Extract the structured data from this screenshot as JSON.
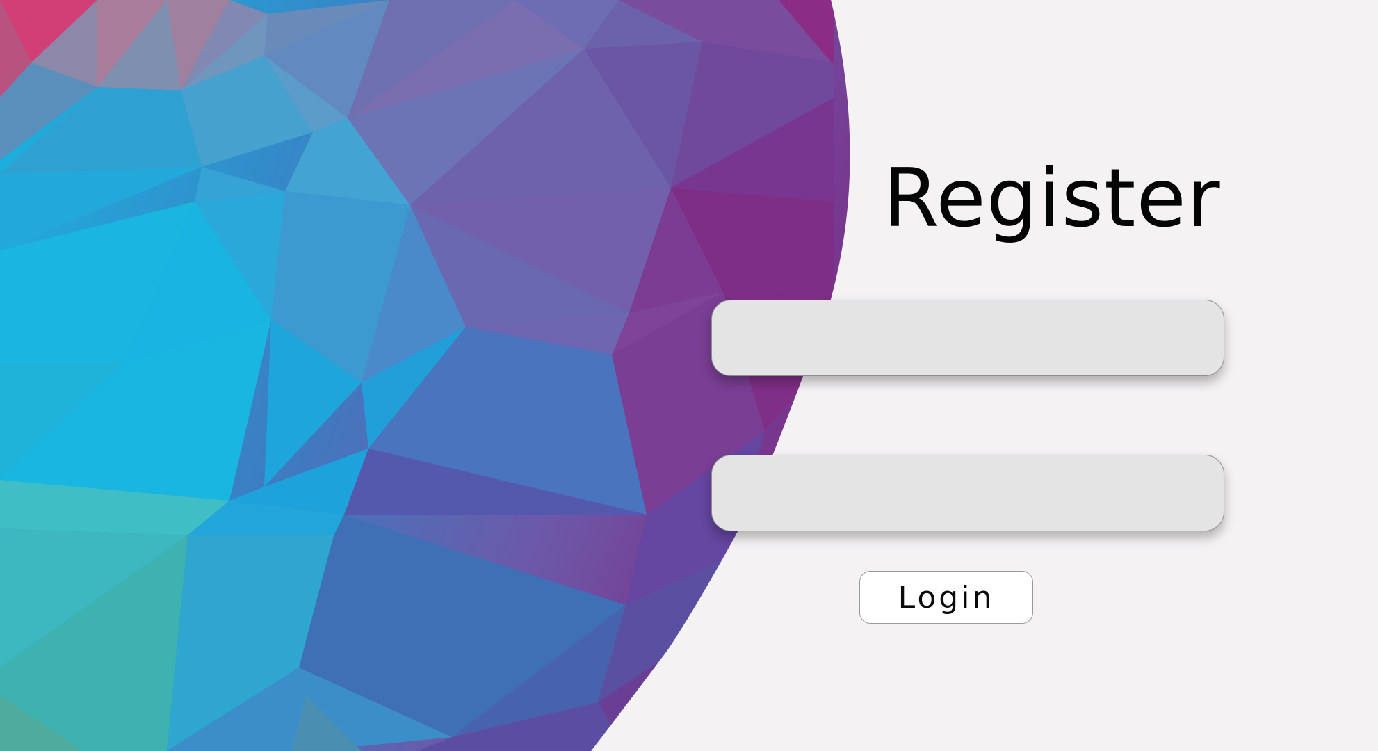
{
  "register_form": {
    "title": "Register",
    "field_1": {
      "value": "",
      "placeholder": ""
    },
    "field_2": {
      "value": "",
      "placeholder": ""
    },
    "login_label": "Login"
  },
  "theme": {
    "page_background": "#f4f2f3",
    "field_background": "#e4e4e4",
    "button_background": "#ffffff",
    "art_palette": [
      "#1bb8de",
      "#3f6fb6",
      "#6b5aa8",
      "#7b2d86",
      "#d43c6e",
      "#3fb6b4"
    ]
  },
  "icons": {
    "background_art": "low-poly-gradient-art"
  }
}
